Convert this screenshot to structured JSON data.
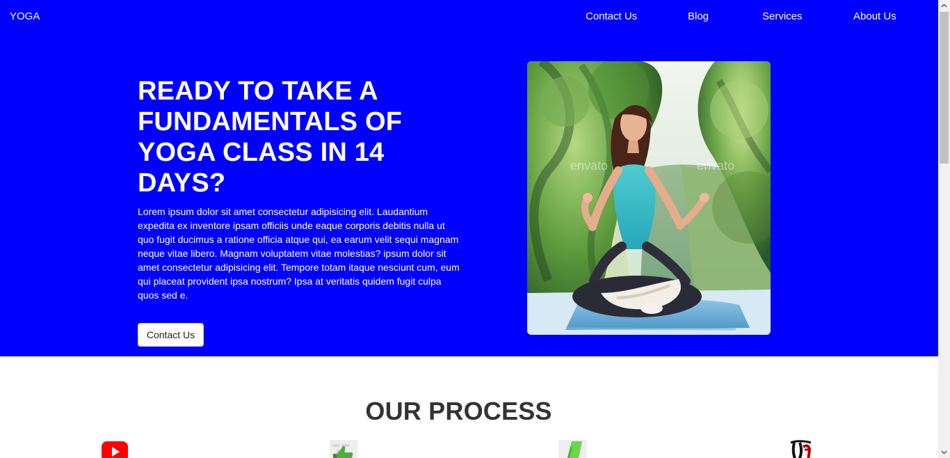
{
  "header": {
    "brand": "YOGA",
    "nav": {
      "contact": "Contact Us",
      "blog": "Blog",
      "services": "Services",
      "about": "About Us"
    }
  },
  "hero": {
    "title": "READY TO TAKE A FUNDAMENTALS OF YOGA CLASS IN 14 DAYS?",
    "description": "Lorem ipsum dolor sit amet consectetur adipisicing elit. Laudantium expedita ex inventore ipsam officiis unde eaque corporis debitis nulla ut quo fugit ducimus a ratione officia atque qui, ea earum velit sequi magnam neque vitae libero. Magnam voluptatem vitae molestias? ipsum dolor sit amet consectetur adipisicing elit. Tempore totam itaque nesciunt cum, eum qui placeat provident ipsa nostrum? Ipsa at veritatis quidem fugit culpa quos sed e.",
    "button_label": "Contact Us",
    "image_watermark": "envato"
  },
  "process": {
    "title": "OUR PROCESS",
    "icons": [
      "youtube-icon",
      "thumbs-up-icon",
      "green-pencil-icon",
      "newspaper-letter-icon"
    ]
  },
  "colors": {
    "hero_background": "#0000ff",
    "hero_text": "#ffffff",
    "section_title": "#333333",
    "button_background": "#ffffff"
  }
}
